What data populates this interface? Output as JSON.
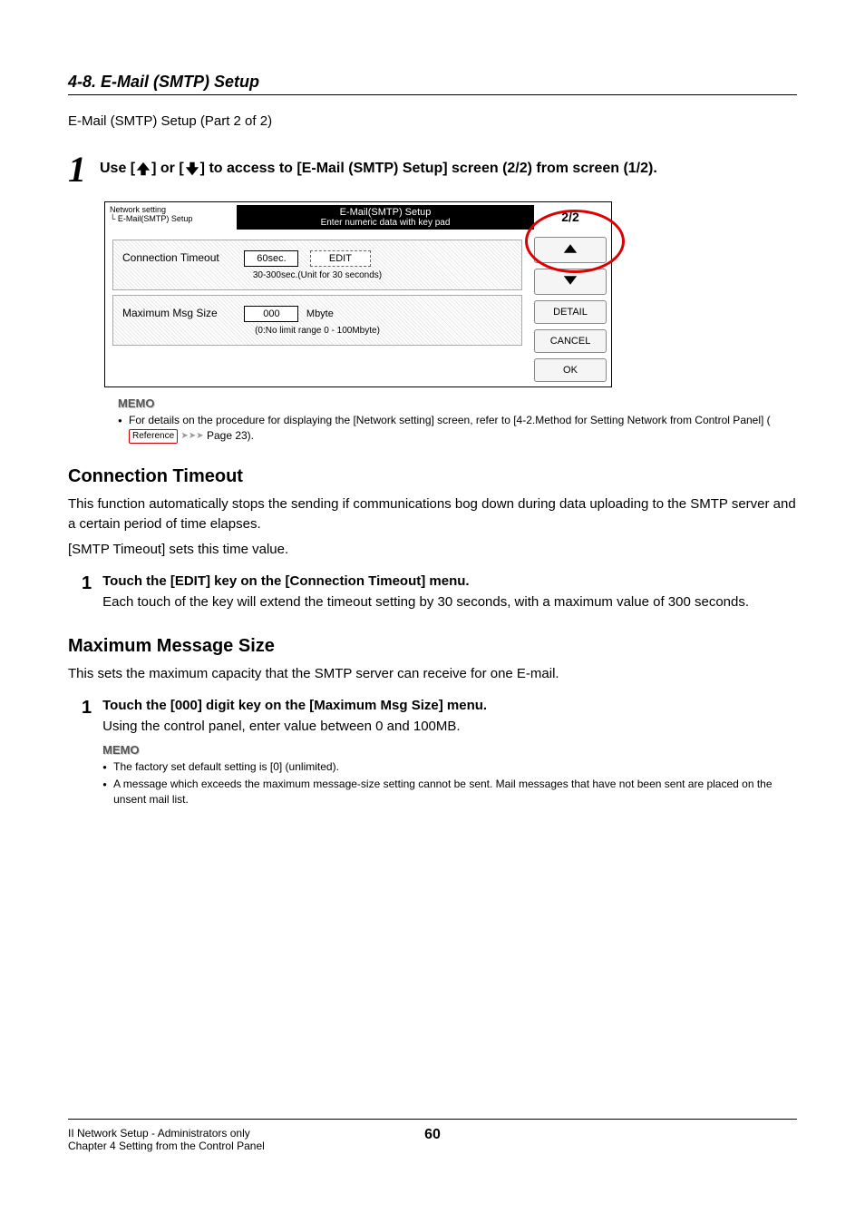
{
  "header": {
    "section": "4-8. E-Mail (SMTP) Setup",
    "subtitle": "E-Mail (SMTP) Setup (Part 2 of 2)"
  },
  "step1": {
    "number": "1",
    "text_prefix": "Use [",
    "text_mid": "] or [",
    "text_suffix": "] to access to [E-Mail (SMTP) Setup] screen (2/2) from screen (1/2)."
  },
  "screenshot": {
    "breadcrumb1": "Network setting",
    "breadcrumb2": "E-Mail(SMTP) Setup",
    "title_line1": "E-Mail(SMTP) Setup",
    "title_line2": "Enter numeric data with key pad",
    "page_indicator": "2/2",
    "row1": {
      "label": "Connection Timeout",
      "value": "60sec.",
      "edit": "EDIT",
      "note": "30-300sec.(Unit for 30 seconds)"
    },
    "row2": {
      "label": "Maximum Msg Size",
      "value": "000",
      "unit": "Mbyte",
      "note": "(0:No limit    range 0 - 100Mbyte)"
    },
    "sidebar": {
      "detail": "DETAIL",
      "cancel": "CANCEL",
      "ok": "OK"
    }
  },
  "memo1": {
    "title": "MEMO",
    "item1_a": "For details on the procedure for displaying the [Network setting] screen, refer to [4-2.Method for Setting Network from Control Panel] (",
    "reference": "Reference",
    "item1_b": " Page 23)."
  },
  "connection_timeout": {
    "heading": "Connection Timeout",
    "para1": "This function automatically stops the sending if communications bog down during data uploading to the SMTP server and a certain period of time elapses.",
    "para2": "[SMTP Timeout] sets this time value.",
    "step": {
      "num": "1",
      "title": "Touch the [EDIT] key on the [Connection Timeout] menu.",
      "body": "Each touch of the key will extend the timeout setting by 30 seconds, with a maximum value of 300 seconds."
    }
  },
  "max_msg_size": {
    "heading": "Maximum Message Size",
    "para": "This sets the maximum capacity that the SMTP server can receive for one E-mail.",
    "step": {
      "num": "1",
      "title": "Touch the [000] digit key on the [Maximum Msg Size] menu.",
      "body": "Using the control panel, enter value between 0 and 100MB."
    },
    "memo": {
      "title": "MEMO",
      "item1": "The factory set default setting is [0] (unlimited).",
      "item2": "A message which exceeds the maximum message-size setting cannot be sent. Mail messages that have not been sent are placed on the unsent mail list."
    }
  },
  "footer": {
    "left1": "II Network Setup - Administrators only",
    "left2": "Chapter 4 Setting from the Control Panel",
    "page": "60"
  }
}
